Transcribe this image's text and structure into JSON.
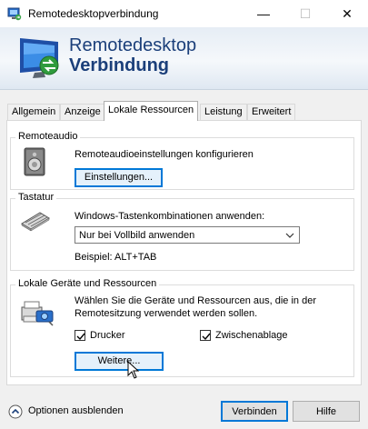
{
  "window": {
    "title": "Remotedesktopverbindung",
    "min_glyph": "—",
    "max_glyph": "☐",
    "close_glyph": "✕"
  },
  "banner": {
    "line1": "Remotedesktop",
    "line2": "Verbindung"
  },
  "tabs": [
    {
      "label": "Allgemein"
    },
    {
      "label": "Anzeige"
    },
    {
      "label": "Lokale Ressourcen"
    },
    {
      "label": "Leistung"
    },
    {
      "label": "Erweitert"
    }
  ],
  "remoteaudio": {
    "title": "Remoteaudio",
    "description": "Remoteaudioeinstellungen konfigurieren",
    "button": "Einstellungen..."
  },
  "keyboard": {
    "title": "Tastatur",
    "label": "Windows-Tastenkombinationen anwenden:",
    "selected": "Nur bei Vollbild anwenden",
    "example": "Beispiel: ALT+TAB"
  },
  "local_devices": {
    "title": "Lokale Geräte und Ressourcen",
    "description_line1": "Wählen Sie die Geräte und Ressourcen aus, die in der",
    "description_line2": "Remotesitzung verwendet werden sollen.",
    "printers_label": "Drucker",
    "printers_checked": true,
    "clipboard_label": "Zwischenablage",
    "clipboard_checked": true,
    "more_button": "Weitere..."
  },
  "footer": {
    "hide_options": "Optionen ausblenden",
    "connect": "Verbinden",
    "help": "Hilfe"
  }
}
